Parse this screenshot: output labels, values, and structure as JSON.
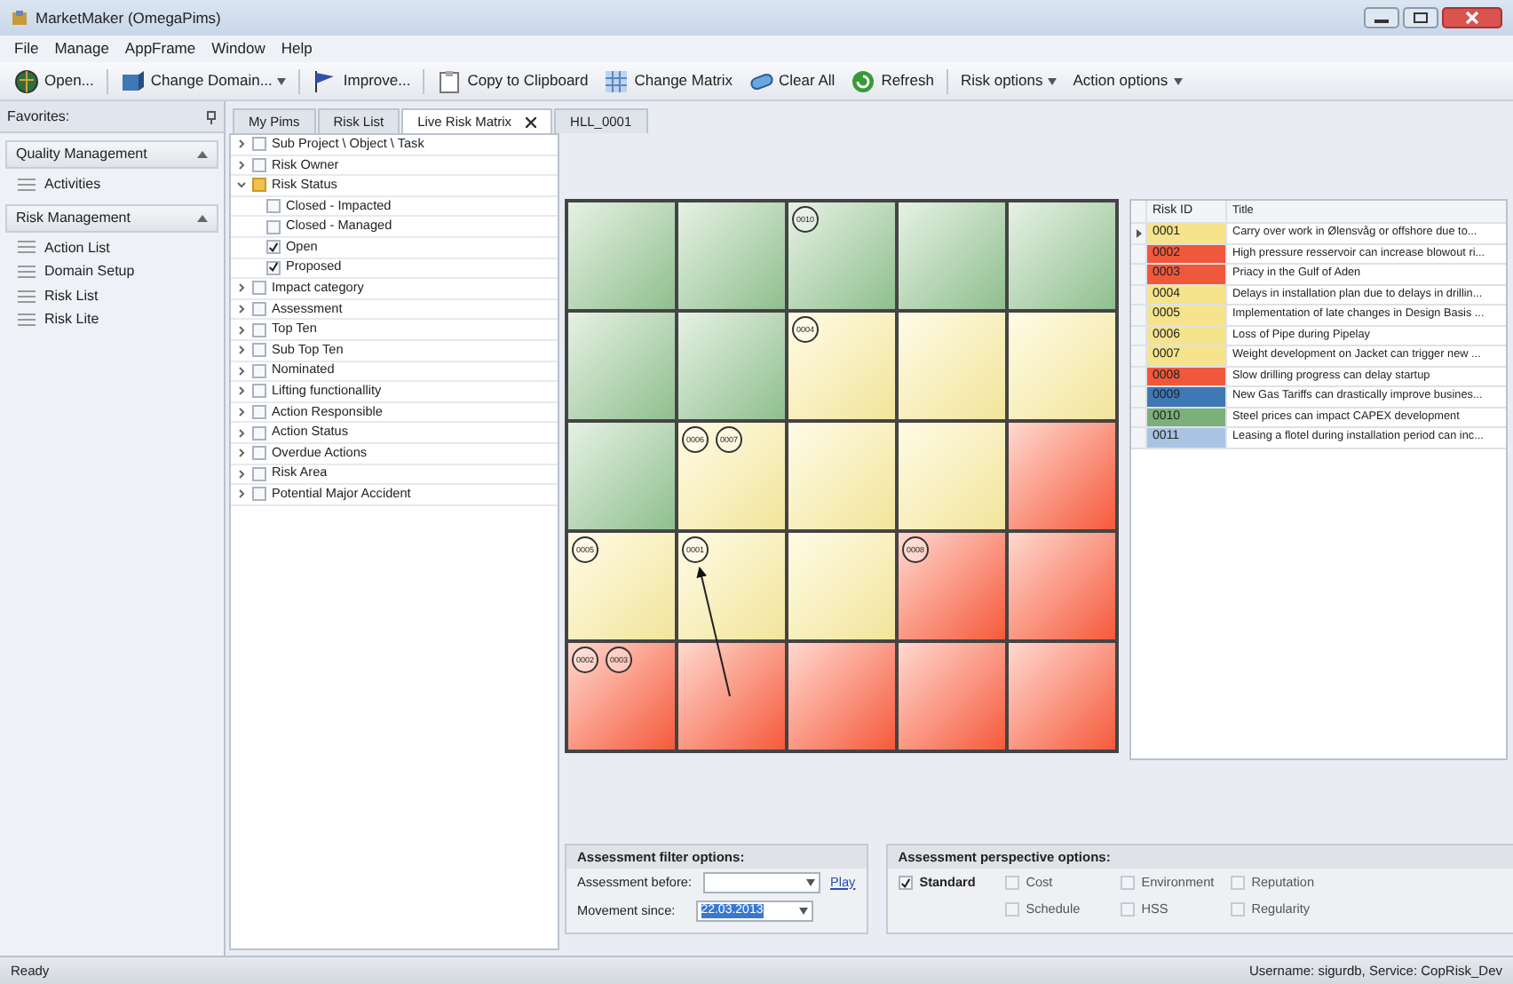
{
  "window": {
    "title": "MarketMaker (OmegaPims)"
  },
  "menu": [
    "File",
    "Manage",
    "AppFrame",
    "Window",
    "Help"
  ],
  "toolbar": [
    {
      "label": "Open...",
      "dropdown": false
    },
    {
      "label": "Change Domain...",
      "dropdown": true
    },
    {
      "label": "Improve...",
      "dropdown": false
    },
    {
      "label": "Copy to Clipboard",
      "dropdown": false
    },
    {
      "label": "Change Matrix",
      "dropdown": false
    },
    {
      "label": "Clear All",
      "dropdown": false
    },
    {
      "label": "Refresh",
      "dropdown": false
    },
    {
      "label": "Risk options",
      "dropdown": true
    },
    {
      "label": "Action options",
      "dropdown": true
    }
  ],
  "sidebar": {
    "title": "Favorites:",
    "groups": [
      {
        "title": "Quality Management",
        "expanded": true,
        "items": [
          "Activities"
        ]
      },
      {
        "title": "Risk Management",
        "expanded": true,
        "items": [
          "Action List",
          "Domain Setup",
          "Risk List",
          "Risk Lite"
        ]
      }
    ]
  },
  "tabs": [
    {
      "label": "My Pims",
      "selected": false,
      "closable": false
    },
    {
      "label": "Risk List",
      "selected": false,
      "closable": false
    },
    {
      "label": "Live Risk Matrix",
      "selected": true,
      "closable": true
    },
    {
      "label": "HLL_0001",
      "selected": false,
      "closable": false
    }
  ],
  "filter_tree": [
    {
      "label": "Sub Project \\ Object \\ Task",
      "expanded": false,
      "checked": false,
      "indeterminate": false
    },
    {
      "label": "Risk Owner",
      "expanded": false,
      "checked": false,
      "indeterminate": false
    },
    {
      "label": "Risk Status",
      "expanded": true,
      "checked": false,
      "indeterminate": true,
      "children": [
        {
          "label": "Closed - Impacted",
          "checked": false
        },
        {
          "label": "Closed - Managed",
          "checked": false
        },
        {
          "label": "Open",
          "checked": true
        },
        {
          "label": "Proposed",
          "checked": true
        }
      ]
    },
    {
      "label": "Impact category",
      "expanded": false,
      "checked": false,
      "indeterminate": false
    },
    {
      "label": "Assessment",
      "expanded": false,
      "checked": false,
      "indeterminate": false
    },
    {
      "label": "Top Ten",
      "expanded": false,
      "checked": false,
      "indeterminate": false
    },
    {
      "label": "Sub Top Ten",
      "expanded": false,
      "checked": false,
      "indeterminate": false
    },
    {
      "label": "Nominated",
      "expanded": false,
      "checked": false,
      "indeterminate": false
    },
    {
      "label": "Lifting functionallity",
      "expanded": false,
      "checked": false,
      "indeterminate": false
    },
    {
      "label": "Action Responsible",
      "expanded": false,
      "checked": false,
      "indeterminate": false
    },
    {
      "label": "Action Status",
      "expanded": false,
      "checked": false,
      "indeterminate": false
    },
    {
      "label": "Overdue Actions",
      "expanded": false,
      "checked": false,
      "indeterminate": false
    },
    {
      "label": "Risk Area",
      "expanded": false,
      "checked": false,
      "indeterminate": false
    },
    {
      "label": "Potential Major Accident",
      "expanded": false,
      "checked": false,
      "indeterminate": false
    }
  ],
  "risk_matrix": {
    "rows": [
      [
        {
          "kind": "green"
        },
        {
          "kind": "green"
        },
        {
          "kind": "green",
          "markers": [
            "0010"
          ]
        },
        {
          "kind": "green"
        },
        {
          "kind": "green"
        }
      ],
      [
        {
          "kind": "green"
        },
        {
          "kind": "green"
        },
        {
          "kind": "yellow",
          "markers": [
            "0004"
          ]
        },
        {
          "kind": "yellow"
        },
        {
          "kind": "yellow"
        }
      ],
      [
        {
          "kind": "green"
        },
        {
          "kind": "yellow",
          "markers": [
            "0006",
            "0007"
          ]
        },
        {
          "kind": "yellow"
        },
        {
          "kind": "yellow"
        },
        {
          "kind": "red"
        }
      ],
      [
        {
          "kind": "yellow",
          "markers": [
            "0005"
          ]
        },
        {
          "kind": "yellow",
          "markers": [
            "0001"
          ]
        },
        {
          "kind": "yellow"
        },
        {
          "kind": "red",
          "markers": [
            "0008"
          ]
        },
        {
          "kind": "red"
        }
      ],
      [
        {
          "kind": "red",
          "markers": [
            "0002",
            "0003"
          ]
        },
        {
          "kind": "red"
        },
        {
          "kind": "red"
        },
        {
          "kind": "red"
        },
        {
          "kind": "red"
        }
      ]
    ]
  },
  "risk_table": {
    "columns": [
      "Risk ID",
      "Title"
    ],
    "rows": [
      {
        "id": "0001",
        "title": "Carry over work in Ølensvåg or offshore due to...",
        "color": "#f5e48c",
        "selected": true
      },
      {
        "id": "0002",
        "title": "High pressure resservoir can increase blowout ri...",
        "color": "#f0583c",
        "selected": false
      },
      {
        "id": "0003",
        "title": "Priacy in the Gulf of Aden",
        "color": "#f0583c",
        "selected": false
      },
      {
        "id": "0004",
        "title": "Delays in installation plan due to delays in drillin...",
        "color": "#f5e48c",
        "selected": false
      },
      {
        "id": "0005",
        "title": "Implementation of late changes in Design Basis ...",
        "color": "#f5e48c",
        "selected": false
      },
      {
        "id": "0006",
        "title": "Loss of Pipe during Pipelay",
        "color": "#f5e48c",
        "selected": false
      },
      {
        "id": "0007",
        "title": "Weight development on Jacket can trigger new ...",
        "color": "#f5e48c",
        "selected": false
      },
      {
        "id": "0008",
        "title": "Slow drilling progress can delay startup",
        "color": "#f0583c",
        "selected": false
      },
      {
        "id": "0009",
        "title": "New Gas Tariffs can drastically improve busines...",
        "color": "#3f78b4",
        "selected": false
      },
      {
        "id": "0010",
        "title": "Steel prices can impact CAPEX development",
        "color": "#7bb07a",
        "selected": false
      },
      {
        "id": "0011",
        "title": "Leasing a flotel during installation period can inc...",
        "color": "#a9c3e3",
        "selected": false
      }
    ]
  },
  "assessment_filter": {
    "title": "Assessment filter options:",
    "before_label": "Assessment before:",
    "play_link": "Play",
    "since_label": "Movement since:",
    "since_value": "22.03.2013"
  },
  "perspective": {
    "title": "Assessment perspective options:",
    "options": [
      {
        "label": "Standard",
        "checked": true,
        "disabled": false
      },
      {
        "label": "Cost",
        "checked": false,
        "disabled": true
      },
      {
        "label": "Environment",
        "checked": false,
        "disabled": true
      },
      {
        "label": "Reputation",
        "checked": false,
        "disabled": true
      },
      {
        "label": "Schedule",
        "checked": false,
        "disabled": true
      },
      {
        "label": "HSS",
        "checked": false,
        "disabled": true
      },
      {
        "label": "Regularity",
        "checked": false,
        "disabled": true
      }
    ]
  },
  "status_bar": {
    "left": "Ready",
    "right": "Username: sigurdb, Service: CopRisk_Dev"
  }
}
